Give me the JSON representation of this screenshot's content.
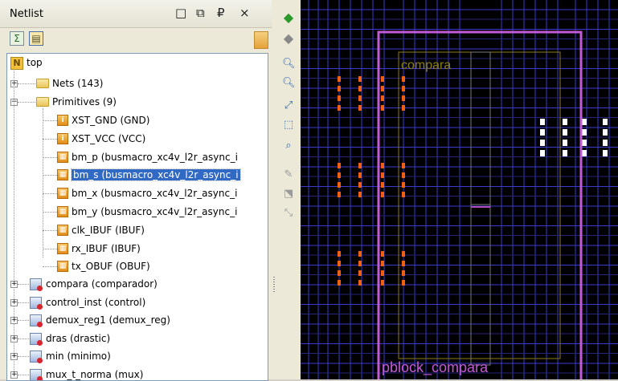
{
  "panel": {
    "title": "Netlist",
    "window_buttons": [
      "□",
      "⧉",
      "₽",
      "×"
    ]
  },
  "toolbar": {
    "expand_all": "expand-all-icon",
    "collapse_all": "collapse-all-icon"
  },
  "tree": {
    "root": "top",
    "nets": "Nets (143)",
    "primitives": "Primitives (9)",
    "primitive_items": [
      "XST_GND (GND)",
      "XST_VCC (VCC)",
      "bm_p (busmacro_xc4v_l2r_async_i",
      "bm_s (busmacro_xc4v_l2r_async_i",
      "bm_x (busmacro_xc4v_l2r_async_i",
      "bm_y (busmacro_xc4v_l2r_async_i",
      "clk_IBUF (IBUF)",
      "rx_IBUF (IBUF)",
      "tx_OBUF (OBUF)"
    ],
    "selected_index": 3,
    "instances": [
      "compara (comparador)",
      "control_inst (control)",
      "demux_reg1 (demux_reg)",
      "dras (drastic)",
      "min (minimo)",
      "mux_t_norma (mux)"
    ]
  },
  "device_tools": [
    "back-icon",
    "forward-icon",
    "zoom-in-icon",
    "zoom-out-icon",
    "zoom-fit-icon",
    "zoom-area-icon",
    "zoom-selected-icon",
    "route-icon",
    "select-icon",
    "move-icon"
  ],
  "device_view": {
    "labels": {
      "region": "compara",
      "pblock": "pblock_compara"
    },
    "colors": {
      "background": "#000000",
      "grid": "#3a3ad0",
      "pblock": "#c35ad8",
      "region": "#8b7d14",
      "site": "#f06010",
      "io": "#ffffff"
    }
  }
}
